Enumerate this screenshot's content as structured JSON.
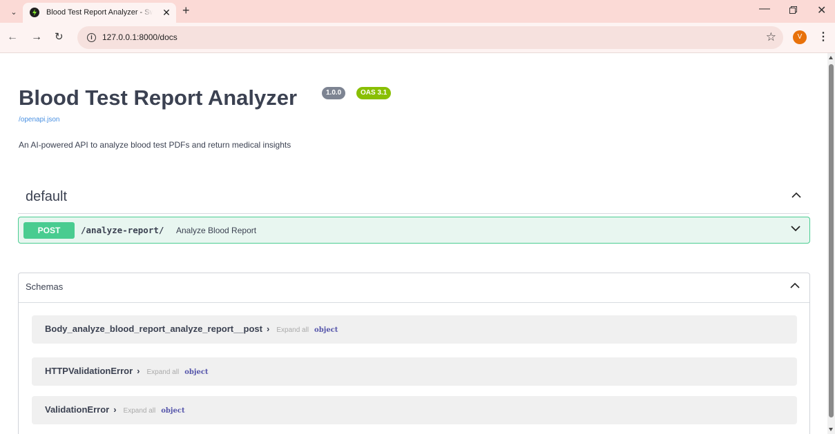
{
  "browser": {
    "tab_title": "Blood Test Report Analyzer - Swagger UI",
    "url": "127.0.0.1:8000/docs",
    "profile_initial": "V"
  },
  "info": {
    "title": "Blood Test Report Analyzer",
    "version": "1.0.0",
    "oas_version": "OAS 3.1",
    "spec_link": "/openapi.json",
    "description": "An AI-powered API to analyze blood test PDFs and return medical insights"
  },
  "tag": {
    "name": "default"
  },
  "operation": {
    "method": "POST",
    "path": "/analyze-report/",
    "summary": "Analyze Blood Report"
  },
  "schemas": {
    "title": "Schemas",
    "expand_all_label": "Expand all",
    "items": [
      {
        "name": "Body_analyze_blood_report_analyze_report__post",
        "type": "object"
      },
      {
        "name": "HTTPValidationError",
        "type": "object"
      },
      {
        "name": "ValidationError",
        "type": "object"
      }
    ]
  },
  "colors": {
    "post_method": "#49cc90",
    "post_background": "#e8f6f0",
    "version_badge": "#7d8492",
    "oas_badge": "#89bf04",
    "link": "#4990e2"
  }
}
